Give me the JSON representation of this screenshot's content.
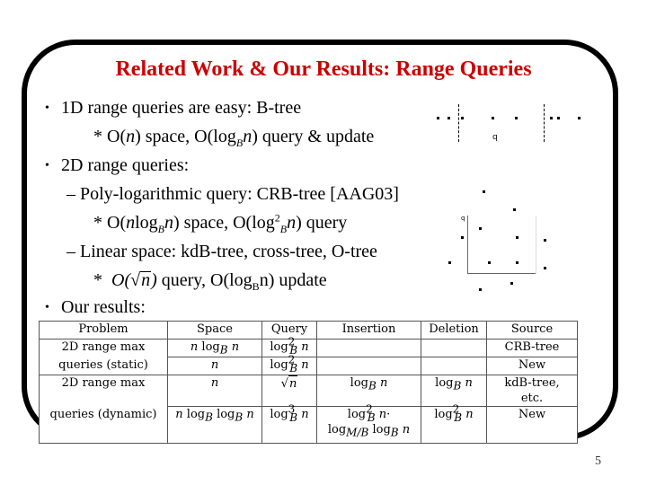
{
  "slide": {
    "title": "Related Work & Our Results: Range Queries",
    "page_number": "5",
    "title_color": "#cc0000"
  },
  "bullets": {
    "b1": "1D range queries are easy: B-tree",
    "b1_sub_pre": "* O(",
    "b1_sub_n": "n",
    "b1_sub_mid": ") space, O(log",
    "b1_sub_B": "B",
    "b1_sub_n2": "n",
    "b1_sub_post": ") query & update",
    "b2": "2D range queries:",
    "b2_a": "– Poly-logarithmic query: CRB-tree [AAG03]",
    "b2_a_sub_pre": "* O(",
    "b2_a_sub_n": "n",
    "b2_a_sub_log": "log",
    "b2_a_sub_B": "B",
    "b2_a_sub_n2": "n",
    "b2_a_sub_mid": ") space, O(log",
    "b2_a_sub_sup": "2",
    "b2_a_sub_B2": "B",
    "b2_a_sub_n3": "n",
    "b2_a_sub_post": ") query",
    "b2_b": "– Linear space: kdB-tree, cross-tree, O-tree",
    "b2_b_sub_star": "*",
    "b2_b_sub_O": "O(",
    "b2_b_sub_sqrt": "n",
    "b2_b_sub_close": ")",
    "b2_b_sub_rest": " query, O(log",
    "b2_b_sub_B": "B",
    "b2_b_sub_end": "n) update",
    "b3": "Our results:"
  },
  "figure_1d": {
    "query_label": "q"
  },
  "figure_2d": {
    "corner_label": "q"
  },
  "table": {
    "headers": [
      "Problem",
      "Space",
      "Query",
      "Insertion",
      "Deletion",
      "Source"
    ],
    "problem_static_line1": "2D range max",
    "problem_static_line2": "queries (static)",
    "problem_dynamic_line1": "2D range max",
    "problem_dynamic_line2": "queries (dynamic)",
    "rows": [
      {
        "space": "n log_B n",
        "query": "log²_B n",
        "insertion": "",
        "deletion": "",
        "source": "CRB-tree"
      },
      {
        "space": "n",
        "query": "log²_B n",
        "insertion": "",
        "deletion": "",
        "source": "New"
      },
      {
        "space": "n",
        "query": "√n",
        "insertion": "log_B n",
        "deletion": "log_B n",
        "source": "kdB-tree, etc."
      },
      {
        "space": "n log_B log_B n",
        "query": "log³_B n",
        "insertion": "log²_B n · log_{M/B} log_B n",
        "deletion": "log²_B n",
        "source": "New"
      }
    ],
    "sym": {
      "n": "n",
      "log": "log",
      "B": "B",
      "two": "2",
      "three": "3",
      "MB": "M/B",
      "dot": "·",
      "sqrt_n": "n"
    }
  }
}
